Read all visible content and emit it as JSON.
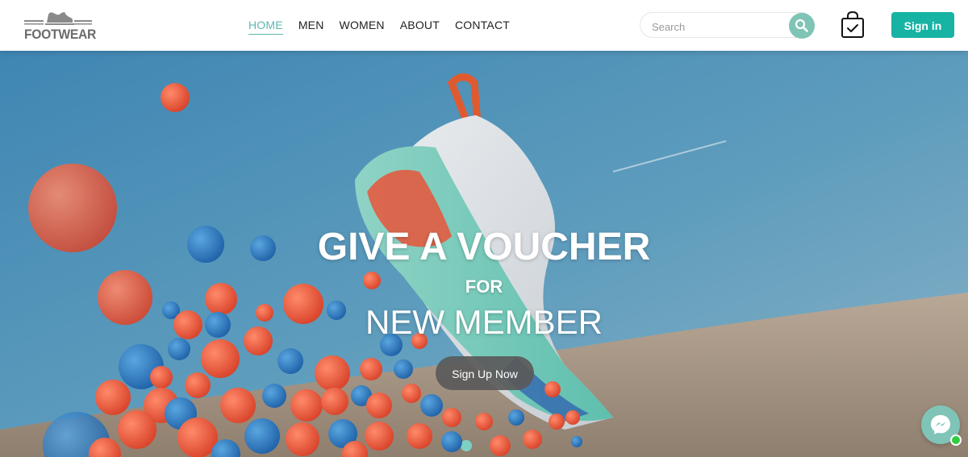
{
  "brand": {
    "logo_text": "FOOTWEAR"
  },
  "nav": {
    "items": [
      {
        "label": "HOME",
        "active": true
      },
      {
        "label": "MEN",
        "active": false
      },
      {
        "label": "WOMEN",
        "active": false
      },
      {
        "label": "ABOUT",
        "active": false
      },
      {
        "label": "CONTACT",
        "active": false
      }
    ]
  },
  "search": {
    "placeholder": "Search",
    "icon": "search-icon"
  },
  "cart": {
    "icon": "shopping-bag-check-icon"
  },
  "account": {
    "signin_label": "Sign in"
  },
  "hero": {
    "title": "GIVE A VOUCHER",
    "connector": "FOR",
    "subtitle": "NEW MEMBER",
    "cta_label": "Sign Up Now"
  },
  "chat": {
    "icon": "messenger-icon",
    "status": "online"
  },
  "colors": {
    "accent": "#17b3a3",
    "accent_light": "#7fc4b6",
    "nav_active": "#5fb7ad",
    "sky": "#5b93b3",
    "ball_red": "#e8553a",
    "ball_blue": "#2f7fc3"
  }
}
